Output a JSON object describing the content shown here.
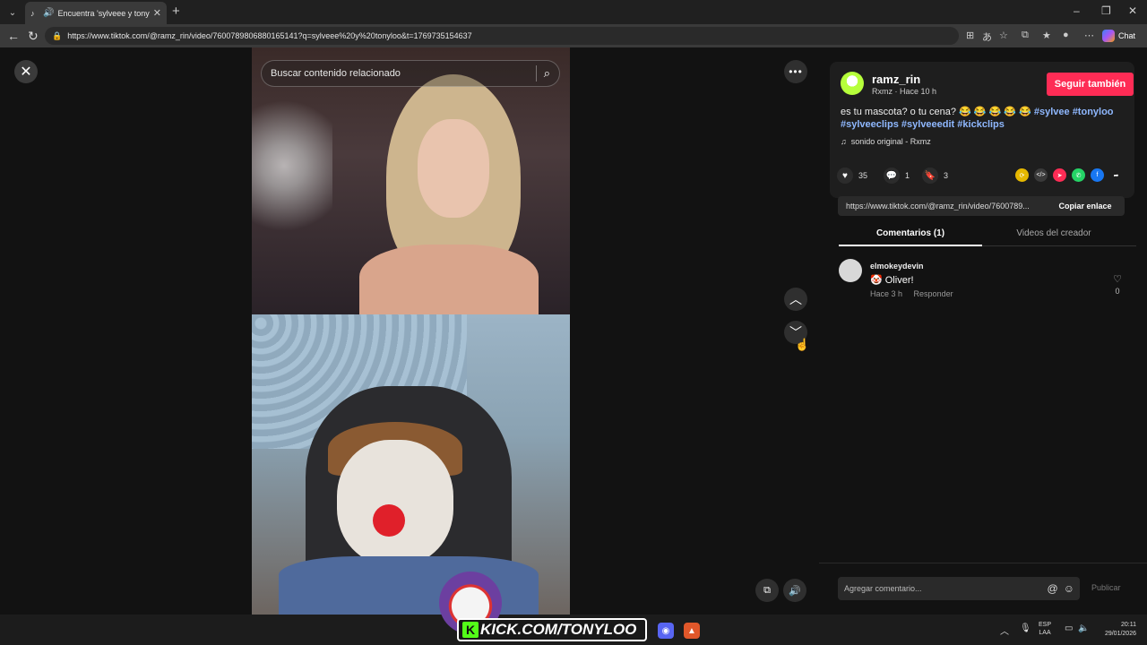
{
  "browser": {
    "tab_title": "Encuentra 'sylveee y tonyloo'",
    "url": "https://www.tiktok.com/@ramz_rin/video/7600789806880165141?q=sylveee%20y%20tonyloo&t=1769735154637",
    "chat_label": "Chat"
  },
  "video": {
    "search_placeholder": "Buscar contenido relacionado"
  },
  "post": {
    "username": "ramz_rin",
    "meta": "Rxmz · Hace 10 h",
    "follow_label": "Seguir también",
    "caption_text": "es tu mascota? o tu cena? 😂 😂 😂 😂 😂",
    "hashtags": [
      "#sylvee",
      "#tonyloo",
      "#sylveeclips",
      "#sylveeedit",
      "#kickclips"
    ],
    "sound": "sonido original - Rxmz",
    "likes": "35",
    "comments": "1",
    "saves": "3",
    "link": "https://www.tiktok.com/@ramz_rin/video/7600789...",
    "copy_label": "Copiar enlace"
  },
  "tabs": {
    "comments_label": "Comentarios (1)",
    "creator_videos_label": "Videos del creador"
  },
  "comment": {
    "user": "elmokeydevin",
    "text": "🤡 Oliver!",
    "time": "Hace 3 h",
    "reply_label": "Responder",
    "likes": "0"
  },
  "comment_input": {
    "placeholder": "Agregar comentario...",
    "publish_label": "Publicar"
  },
  "overlay": {
    "kick_text": "KICK.COM/TONYLOO",
    "kick_letter": "K"
  },
  "taskbar": {
    "lang_top": "ESP",
    "lang_bottom": "LAA",
    "time": "20:11",
    "date": "29/01/2026"
  },
  "colors": {
    "follow_button": "#fe2c55",
    "hashtag": "#8fb8ff",
    "kick_green": "#53fc18"
  }
}
